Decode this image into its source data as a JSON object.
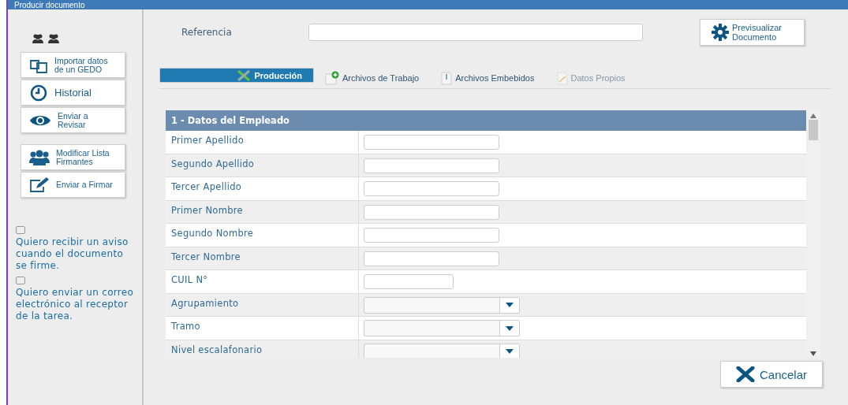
{
  "window": {
    "title": "Producir documento"
  },
  "sidebar": {
    "actions": [
      {
        "kind": "import",
        "label": "Importar datos de un GEDO"
      },
      {
        "kind": "history",
        "label": "Historial"
      },
      {
        "kind": "review",
        "label": "Enviar a Revisar"
      },
      {
        "kind": "signers",
        "label": "Modificar Lista Firmantes"
      },
      {
        "kind": "sign",
        "label": "Enviar a Firmar"
      }
    ],
    "options": [
      {
        "checked": false,
        "label": "Quiero recibir un aviso cuando el documento se firme."
      },
      {
        "checked": false,
        "label": "Quiero enviar un correo electrónico al receptor de la tarea."
      }
    ]
  },
  "referencia": {
    "label": "Referencia"
  },
  "preview_button": "Previsualizar Documento",
  "tabs": [
    {
      "kind": "tools",
      "label": "Producción",
      "selected": true,
      "disabled": false
    },
    {
      "kind": "add-file",
      "label": "Archivos de Trabajo",
      "selected": false,
      "disabled": false
    },
    {
      "kind": "clip-file",
      "label": "Archivos Embebidos",
      "selected": false,
      "disabled": false
    },
    {
      "kind": "edit-file",
      "label": "Datos Propios",
      "selected": false,
      "disabled": true
    }
  ],
  "form": {
    "title": "1 - Datos del Empleado",
    "rows": [
      {
        "label": "Primer Apellido",
        "kind": "text"
      },
      {
        "label": "Segundo Apellido",
        "kind": "text"
      },
      {
        "label": "Tercer Apellido",
        "kind": "text"
      },
      {
        "label": "Primer Nombre",
        "kind": "text"
      },
      {
        "label": "Segundo Nombre",
        "kind": "text"
      },
      {
        "label": "Tercer Nombre",
        "kind": "text"
      },
      {
        "label": "CUIL N°",
        "kind": "short-text"
      },
      {
        "label": "Agrupamiento",
        "kind": "select"
      },
      {
        "label": "Tramo",
        "kind": "select"
      },
      {
        "label": "Nivel escalafonario",
        "kind": "select"
      }
    ]
  },
  "cancel_button": "Cancelar"
}
